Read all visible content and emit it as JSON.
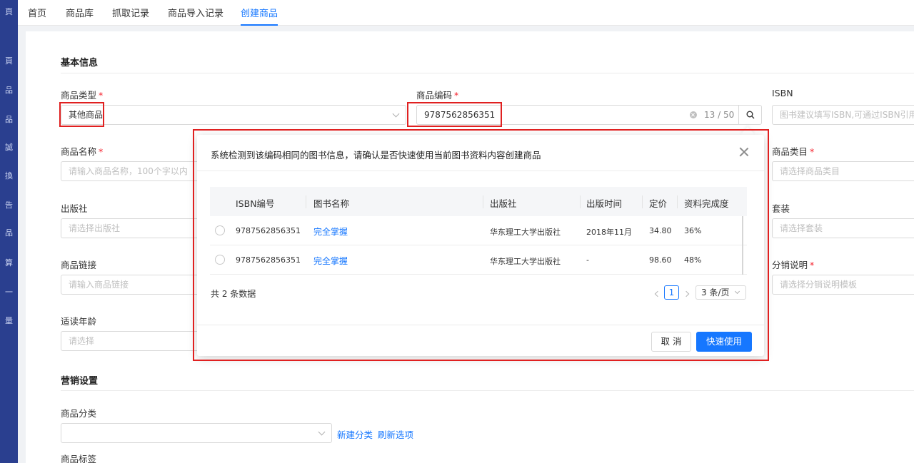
{
  "sidebar": {
    "items": [
      "頁",
      "品",
      "品",
      "誠",
      "換",
      "告",
      "品",
      "算",
      "一",
      "量"
    ]
  },
  "tabs": [
    "首页",
    "商品库",
    "抓取记录",
    "商品导入记录",
    "创建商品"
  ],
  "form": {
    "basic_title": "基本信息",
    "product_type_label": "商品类型",
    "product_type_value": "其他商品",
    "code_label": "商品编码",
    "code_value": "9787562856351",
    "code_count": "13 / 50",
    "isbn_label": "ISBN",
    "isbn_placeholder": "图书建议填写ISBN,可通过ISBN引用",
    "name_label": "商品名称",
    "name_placeholder": "请输入商品名称，100个字以内",
    "category_label": "商品类目",
    "category_placeholder": "请选择商品类目",
    "publisher_label": "出版社",
    "publisher_placeholder": "请选择出版社",
    "set_label": "套装",
    "set_placeholder": "请选择套装",
    "link_label": "商品链接",
    "link_placeholder": "请输入商品链接",
    "distribution_label": "分销说明",
    "distribution_placeholder": "请选择分销说明模板",
    "age_label": "适读年龄",
    "age_placeholder": "请选择",
    "marketing_title": "营销设置",
    "classify_label": "商品分类",
    "new_classify": "新建分类",
    "refresh_options": "刷新选项",
    "tag_label": "商品标签",
    "required_mark": "*"
  },
  "modal": {
    "title": "系统检测到该编码相同的图书信息，请确认是否快速使用当前图书资料内容创建商品",
    "columns": [
      "ISBN编号",
      "图书名称",
      "出版社",
      "出版时间",
      "定价",
      "资料完成度"
    ],
    "rows": [
      {
        "isbn": "9787562856351",
        "name": "完全掌握",
        "publisher": "华东理工大学出版社",
        "date": "2018年11月",
        "price": "34.80",
        "completion": "36%"
      },
      {
        "isbn": "9787562856351",
        "name": "完全掌握",
        "publisher": "华东理工大学出版社",
        "date": "-",
        "price": "98.60",
        "completion": "48%"
      }
    ],
    "total": "共 2 条数据",
    "current_page": "1",
    "page_size": "3 条/页",
    "cancel": "取 消",
    "confirm": "快速使用"
  },
  "colors": {
    "primary": "#1677ff",
    "sidebar": "#2a3f8f",
    "highlight": "#e02020",
    "required": "#f5222d"
  },
  "icons": [
    "search-icon",
    "clear-icon",
    "close-icon",
    "chevron-down-icon",
    "chevron-left-icon",
    "chevron-right-icon"
  ]
}
